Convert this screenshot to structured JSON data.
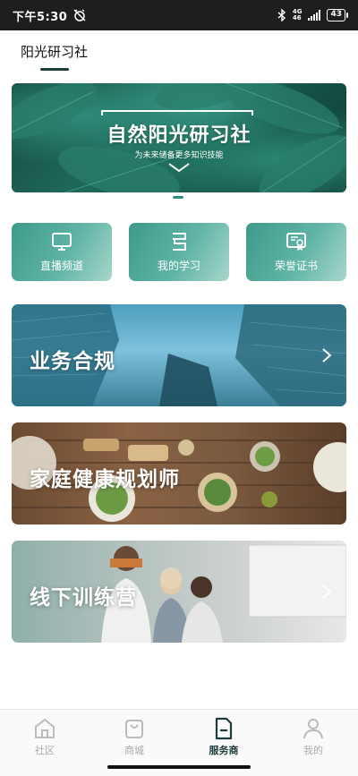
{
  "status_bar": {
    "time": "下午5:30",
    "network": "4G",
    "network_sub": "46",
    "battery": "43"
  },
  "header": {
    "tab_title": "阳光研习社"
  },
  "banner": {
    "title": "自然阳光研习社",
    "subtitle": "为未来储备更多知识技能"
  },
  "quick_actions": [
    {
      "label": "直播频道",
      "icon": "tv-icon"
    },
    {
      "label": "我的学习",
      "icon": "study-icon"
    },
    {
      "label": "荣誉证书",
      "icon": "certificate-icon"
    }
  ],
  "cards": [
    {
      "label": "业务合规"
    },
    {
      "label": "家庭健康规划师"
    },
    {
      "label": "线下训练营"
    }
  ],
  "bottom_nav": [
    {
      "label": "社区",
      "icon": "community-icon",
      "active": false
    },
    {
      "label": "商城",
      "icon": "shop-bag-icon",
      "active": false
    },
    {
      "label": "服务商",
      "icon": "service-doc-icon",
      "active": true
    },
    {
      "label": "我的",
      "icon": "profile-icon",
      "active": false
    }
  ],
  "colors": {
    "accent": "#1c3b3a",
    "quick_button": "#4fa696",
    "inactive_nav": "#aaaaaa"
  }
}
